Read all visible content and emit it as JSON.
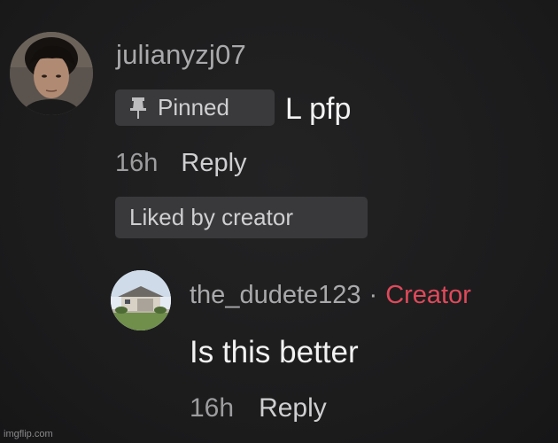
{
  "main_comment": {
    "username": "julianyzj07",
    "pinned_label": "Pinned",
    "text": "L pfp",
    "time": "16h",
    "reply_label": "Reply",
    "liked_label": "Liked by creator"
  },
  "reply_comment": {
    "username": "the_dudete123",
    "separator": "·",
    "creator_label": "Creator",
    "text": "Is this better",
    "time": "16h",
    "reply_label": "Reply"
  },
  "watermark": "imgflip.com",
  "colors": {
    "background": "#1c1c1d",
    "badge_bg": "#3a3a3c",
    "username": "#a9a9ab",
    "creator_accent": "#e0495a",
    "comment_text": "#f2f2f2"
  },
  "icons": {
    "pin": "pin-icon"
  }
}
